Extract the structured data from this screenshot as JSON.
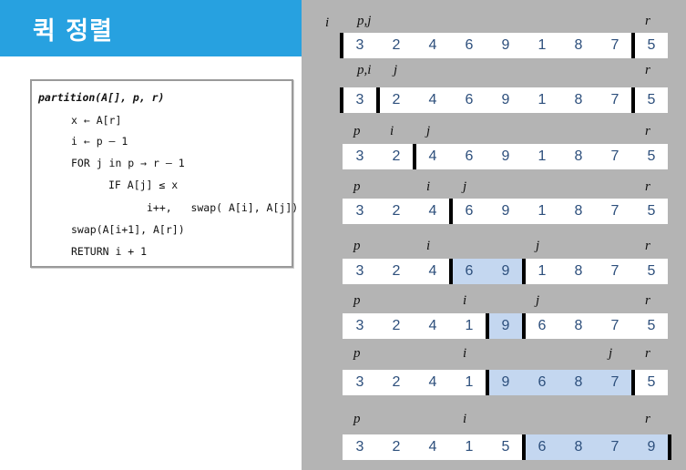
{
  "title": "퀵 정렬",
  "code": [
    "partition(A[], p, r)",
    "x ← A[r]",
    "i ← p – 1",
    "FOR j in p → r – 1",
    "IF A[j] ≤ x",
    "i++,   swap( A[i], A[j])",
    "swap(A[i+1], A[r])",
    "RETURN i + 1"
  ],
  "colors": {
    "title_bg": "#27a1e0",
    "panel_bg": "#b4b4b4",
    "highlight": "#c4d7f0",
    "digit": "#2d4f7c"
  },
  "rows": [
    {
      "values": [
        "3",
        "2",
        "4",
        "6",
        "9",
        "1",
        "8",
        "7",
        "5"
      ],
      "highlight": [],
      "dividers": [
        0,
        8
      ],
      "pointers": [
        {
          "label": "i",
          "slot": -0.3
        },
        {
          "label": "p,j",
          "slot": 0.1
        },
        {
          "label": "r",
          "slot": 8
        }
      ]
    },
    {
      "values": [
        "3",
        "2",
        "4",
        "6",
        "9",
        "1",
        "8",
        "7",
        "5"
      ],
      "highlight": [],
      "dividers": [
        0,
        1,
        8
      ],
      "pointers": [
        {
          "label": "p,i",
          "slot": 0.1
        },
        {
          "label": "j",
          "slot": 1.1
        },
        {
          "label": "r",
          "slot": 8
        }
      ]
    },
    {
      "values": [
        "3",
        "2",
        "4",
        "6",
        "9",
        "1",
        "8",
        "7",
        "5"
      ],
      "highlight": [],
      "dividers": [
        2
      ],
      "pointers": [
        {
          "label": "p",
          "slot": 0
        },
        {
          "label": "i",
          "slot": 1
        },
        {
          "label": "j",
          "slot": 2
        },
        {
          "label": "r",
          "slot": 8
        }
      ]
    },
    {
      "values": [
        "3",
        "2",
        "4",
        "6",
        "9",
        "1",
        "8",
        "7",
        "5"
      ],
      "highlight": [],
      "dividers": [
        3
      ],
      "pointers": [
        {
          "label": "p",
          "slot": 0
        },
        {
          "label": "i",
          "slot": 2
        },
        {
          "label": "j",
          "slot": 3
        },
        {
          "label": "r",
          "slot": 8
        }
      ]
    },
    {
      "values": [
        "3",
        "2",
        "4",
        "6",
        "9",
        "1",
        "8",
        "7",
        "5"
      ],
      "highlight": [
        3,
        4
      ],
      "dividers": [
        3,
        5
      ],
      "pointers": [
        {
          "label": "p",
          "slot": 0
        },
        {
          "label": "i",
          "slot": 2
        },
        {
          "label": "j",
          "slot": 5
        },
        {
          "label": "r",
          "slot": 8
        }
      ]
    },
    {
      "values": [
        "3",
        "2",
        "4",
        "1",
        "9",
        "6",
        "8",
        "7",
        "5"
      ],
      "highlight": [
        4
      ],
      "dividers": [
        4,
        5
      ],
      "pointers": [
        {
          "label": "p",
          "slot": 0
        },
        {
          "label": "i",
          "slot": 3
        },
        {
          "label": "j",
          "slot": 5
        },
        {
          "label": "r",
          "slot": 8
        }
      ]
    },
    {
      "values": [
        "3",
        "2",
        "4",
        "1",
        "9",
        "6",
        "8",
        "7",
        "5"
      ],
      "highlight": [
        4,
        5,
        6,
        7
      ],
      "dividers": [
        4,
        8
      ],
      "pointers": [
        {
          "label": "p",
          "slot": 0
        },
        {
          "label": "i",
          "slot": 3
        },
        {
          "label": "j",
          "slot": 7
        },
        {
          "label": "r",
          "slot": 8
        }
      ]
    },
    {
      "values": [
        "3",
        "2",
        "4",
        "1",
        "5",
        "6",
        "8",
        "7",
        "9"
      ],
      "highlight": [
        5,
        6,
        7,
        8
      ],
      "dividers": [
        5,
        9
      ],
      "pointers": [
        {
          "label": "p",
          "slot": 0
        },
        {
          "label": "i",
          "slot": 3
        },
        {
          "label": "r",
          "slot": 8
        }
      ]
    }
  ]
}
